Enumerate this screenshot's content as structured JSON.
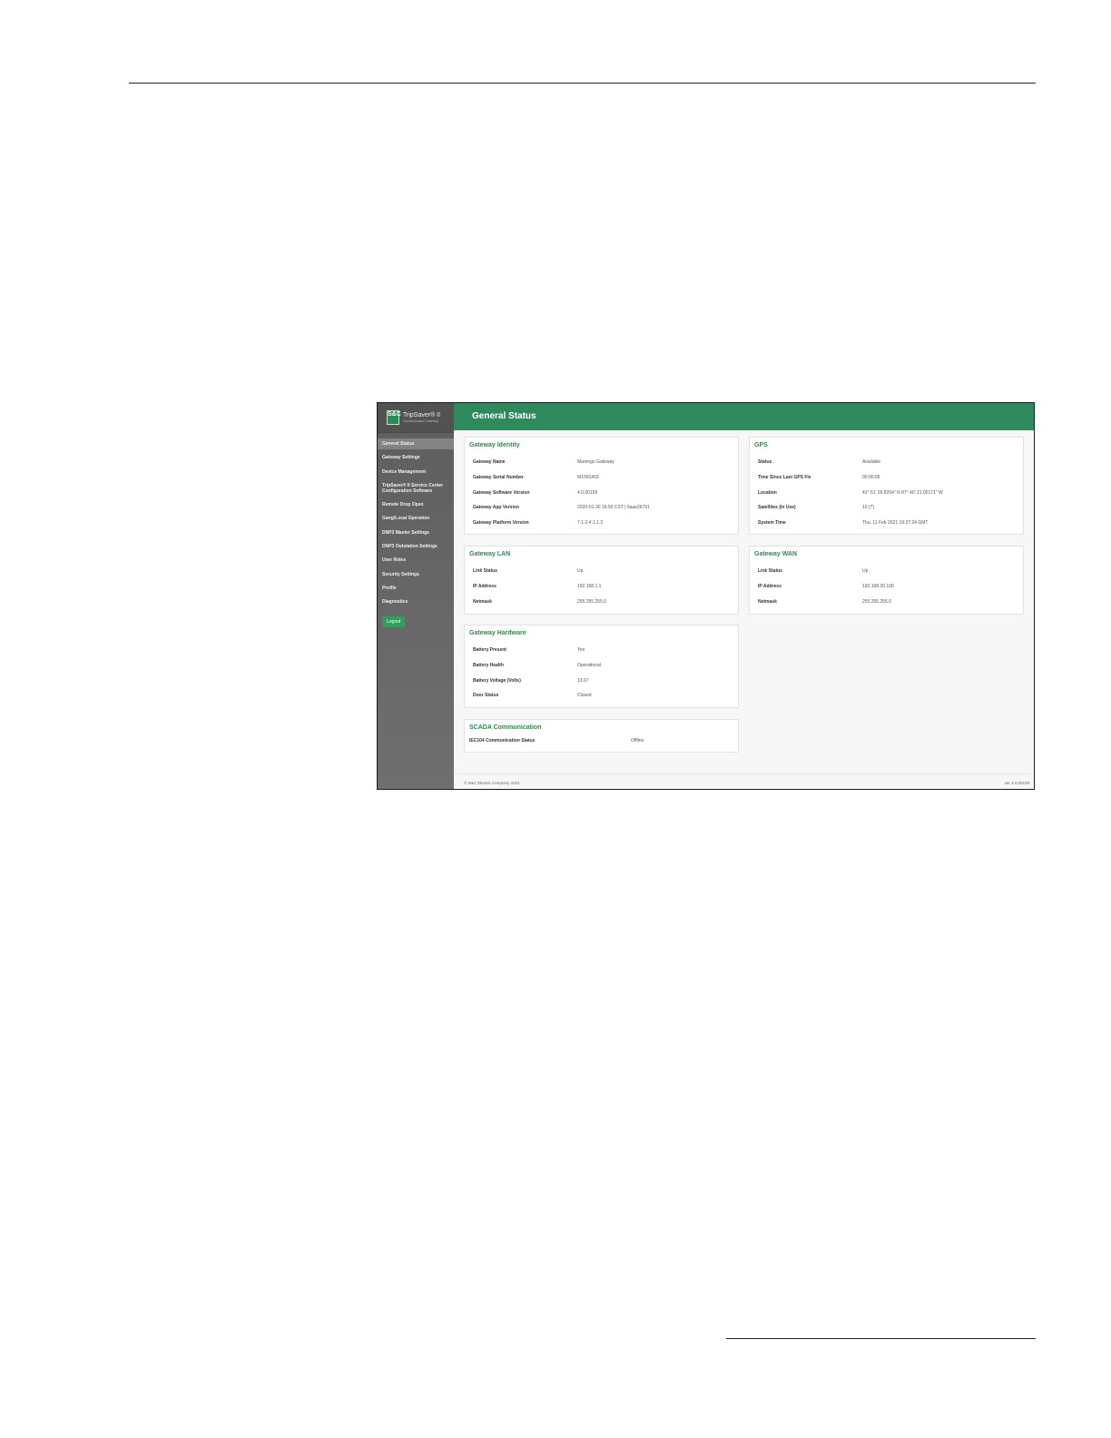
{
  "logo": {
    "badge": "S&C",
    "name": "TripSaver® II",
    "sub": "Communication Gateway"
  },
  "sidebar": {
    "items": [
      "General Status",
      "Gateway Settings",
      "Device Management",
      "TripSaver® II Service Center Configuration Software",
      "Remote Drop Open",
      "Gang/Local Operation",
      "DNP3 Master Settings",
      "DNP3 Outstation Settings",
      "User Roles",
      "Security Settings",
      "Profile",
      "Diagnostics"
    ],
    "logout": "Logout"
  },
  "header": {
    "title": "General Status"
  },
  "identity": {
    "title": "Gateway Identity",
    "rows": [
      [
        "Gateway Name",
        "Marengo Gateway"
      ],
      [
        "Gateway Serial Number",
        "M1001403"
      ],
      [
        "Gateway Software Version",
        "4.0.00159"
      ],
      [
        "Gateway App Version",
        "2020-01-30 16:56 CST | 6aae26791"
      ],
      [
        "Gateway Platform Version",
        "7.1.2-4.1.1.3"
      ]
    ]
  },
  "gps": {
    "title": "GPS",
    "rows": [
      [
        "Status",
        "Available"
      ],
      [
        "Time Since Last GPS Fix",
        "00:00:05"
      ],
      [
        "Location",
        "41° 51' 29.8204\" N 87° 40' 21.05171\" W"
      ],
      [
        "Satellites (In Use)",
        "10 (7)"
      ],
      [
        "System Time",
        "Thu, 11 Feb 2021 19:37:24 GMT"
      ]
    ]
  },
  "lan": {
    "title": "Gateway LAN",
    "rows": [
      [
        "Link Status",
        "Up"
      ],
      [
        "IP Address",
        "192.168.1.1"
      ],
      [
        "Netmask",
        "255.255.255.0"
      ]
    ]
  },
  "wan": {
    "title": "Gateway WAN",
    "rows": [
      [
        "Link Status",
        "Up"
      ],
      [
        "IP Address",
        "192.168.20.100"
      ],
      [
        "Netmask",
        "255.255.255.0"
      ]
    ]
  },
  "hardware": {
    "title": "Gateway Hardware",
    "rows": [
      [
        "Battery Present",
        "Yes"
      ],
      [
        "Battery Health",
        "Operational"
      ],
      [
        "Battery Voltage (Volts)",
        "13.67"
      ],
      [
        "Door Status",
        "Closed"
      ]
    ]
  },
  "scada": {
    "title": "SCADA Communication",
    "rows": [
      [
        "IEC104 Communication Status",
        "Offline"
      ]
    ]
  },
  "footer": {
    "copyright": "© S&C Electric Company 2021",
    "version": "ver 4.0.00159"
  }
}
